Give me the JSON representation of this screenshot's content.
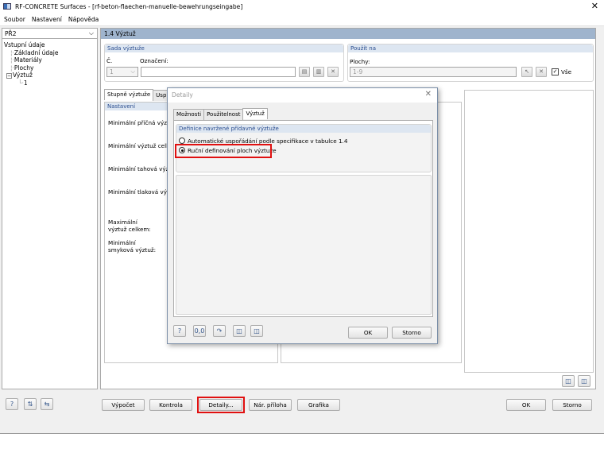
{
  "window": {
    "title": "RF-CONCRETE Surfaces - [rf-beton-flaechen-manuelle-bewehrungseingabe]",
    "close": "✕"
  },
  "menu": [
    "Soubor",
    "Nastavení",
    "Nápověda"
  ],
  "nav": {
    "case": "PŘ2",
    "tree": {
      "root": "Vstupní údaje",
      "children": [
        "Základní údaje",
        "Materiály",
        "Plochy"
      ],
      "vyztuz": "Výztuž",
      "vyztuz_child": "1"
    }
  },
  "main": {
    "header": "1.4 Výztuž",
    "sada": {
      "title": "Sada výztuže",
      "num_label": "Č.",
      "num_value": "1",
      "name_label": "Označení:",
      "name_value": ""
    },
    "pouzit": {
      "title": "Použít na",
      "plochy_label": "Plochy:",
      "plochy_value": "1-9",
      "vse": "Vše"
    },
    "tabs": [
      "Stupně výztuže",
      "Usp"
    ],
    "nastaveni": {
      "title": "Nastavení",
      "rows": [
        "Minimální příčná výztuž",
        "Minimální výztuž celkem",
        "Minimální tahová výztuž",
        "Minimální tlaková výztuž"
      ],
      "max1": "Maximální",
      "max2": "výztuž celkem:",
      "min1": "Minimální",
      "min2": "smyková výztuž:"
    }
  },
  "dialog": {
    "title": "Detaily",
    "tabs": [
      "Možnosti",
      "Použitelnost",
      "Výztuž"
    ],
    "group_title": "Definice navržené přídavné výztuže",
    "option_auto": "Automatické uspořádání podle specifikace v tabulce 1.4",
    "option_manual": "Ruční definování ploch výztuže",
    "ok": "OK",
    "storno": "Storno"
  },
  "bottom": {
    "vypocet": "Výpočet",
    "kontrola": "Kontrola",
    "detaily": "Detaily...",
    "nar_priloha": "Nár. příloha",
    "grafika": "Grafika",
    "ok": "OK",
    "storno": "Storno"
  },
  "colors": {
    "header": "#9fb4cd",
    "group_title": "#dde6f1",
    "highlight": "#e01010"
  }
}
